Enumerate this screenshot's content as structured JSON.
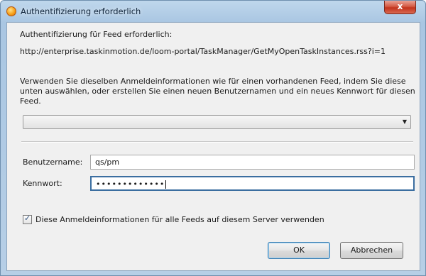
{
  "window": {
    "title": "Authentifizierung erforderlich",
    "close_glyph": "x"
  },
  "dialog": {
    "heading": "Authentifizierung für Feed erforderlich:",
    "url": "http://enterprise.taskinmotion.de/loom-portal/TaskManager/GetMyOpenTaskInstances.rss?i=1",
    "description": "Verwenden Sie dieselben Anmeldeinformationen wie für einen vorhandenen Feed, indem Sie diese unten auswählen, oder erstellen Sie einen neuen Benutzernamen und ein neues Kennwort für diesen Feed.",
    "existing_feed_select": {
      "selected_value": ""
    },
    "username": {
      "label": "Benutzername:",
      "value": "qs/pm"
    },
    "password": {
      "label": "Kennwort:",
      "masked_value": "•••••••••••••"
    },
    "apply_all": {
      "label": "Diese Anmeldeinformationen für alle Feeds auf diesem Server verwenden",
      "checked": true
    },
    "buttons": {
      "ok": "OK",
      "cancel": "Abbrechen"
    }
  },
  "icons": {
    "app": "app-logo-icon",
    "dropdown": "chevron-down-icon",
    "close": "close-icon",
    "check": "checkmark-icon"
  },
  "colors": {
    "titlebar": "#b7cfe6",
    "close_button": "#c2331c",
    "dialog_background": "#f0f0f0",
    "focus_border": "#3b6ea0"
  }
}
